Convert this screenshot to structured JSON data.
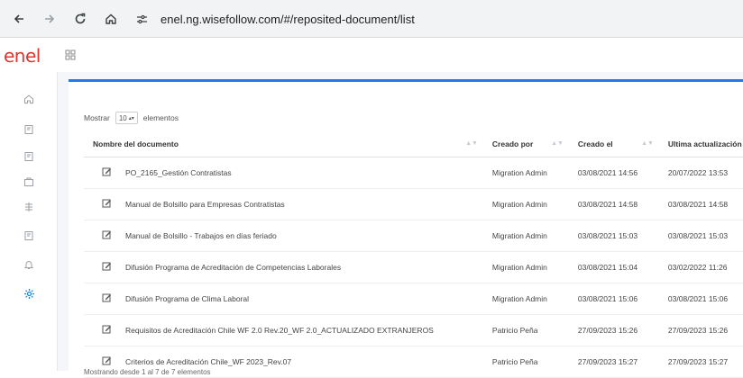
{
  "browser": {
    "url": "enel.ng.wisefollow.com/#/reposited-document/list",
    "back_icon": "arrow-left-icon",
    "forward_icon": "arrow-right-icon",
    "reload_icon": "reload-icon",
    "home_icon": "home-icon"
  },
  "app": {
    "logo": "enel",
    "brand_color": "#e3342f",
    "accent_color": "#1a7fe0"
  },
  "sidebar": {
    "items": [
      {
        "icon": "home-icon"
      },
      {
        "icon": "document-icon"
      },
      {
        "icon": "document-icon"
      },
      {
        "icon": "briefcase-icon"
      },
      {
        "icon": "list-icon"
      },
      {
        "icon": "document-icon"
      },
      {
        "icon": "bell-icon"
      },
      {
        "icon": "gear-icon",
        "active": true
      }
    ]
  },
  "list": {
    "show_label": "Mostrar",
    "page_size": "10",
    "elements_label": "elementos",
    "columns": [
      "Nombre del documento",
      "Creado por",
      "Creado el",
      "Ultima actualización"
    ],
    "rows": [
      {
        "name": "PO_2165_Gestión Contratistas",
        "created_by": "Migration Admin",
        "created_on": "03/08/2021 14:56",
        "updated_on": "20/07/2022 13:53"
      },
      {
        "name": "Manual de Bolsillo para Empresas Contratistas",
        "created_by": "Migration Admin",
        "created_on": "03/08/2021 14:58",
        "updated_on": "03/08/2021 14:58"
      },
      {
        "name": "Manual de Bolsillo - Trabajos en días feriado",
        "created_by": "Migration Admin",
        "created_on": "03/08/2021 15:03",
        "updated_on": "03/08/2021 15:03"
      },
      {
        "name": "Difusión Programa de Acreditación de Competencias Laborales",
        "created_by": "Migration Admin",
        "created_on": "03/08/2021 15:04",
        "updated_on": "03/02/2022 11:26"
      },
      {
        "name": "Difusión Programa de Clima Laboral",
        "created_by": "Migration Admin",
        "created_on": "03/08/2021 15:06",
        "updated_on": "03/08/2021 15:06"
      },
      {
        "name": "Requisitos de Acreditación Chile WF 2.0 Rev.20_WF 2.0_ACTUALIZADO EXTRANJEROS",
        "created_by": "Patricio Peña",
        "created_on": "27/09/2023 15:26",
        "updated_on": "27/09/2023 15:26"
      },
      {
        "name": "Criterios de Acreditación Chile_WF 2023_Rev.07",
        "created_by": "Patricio Peña",
        "created_on": "27/09/2023 15:27",
        "updated_on": "27/09/2023 15:27"
      }
    ],
    "footer": "Mostrando desde 1 al 7 de 7 elementos"
  }
}
